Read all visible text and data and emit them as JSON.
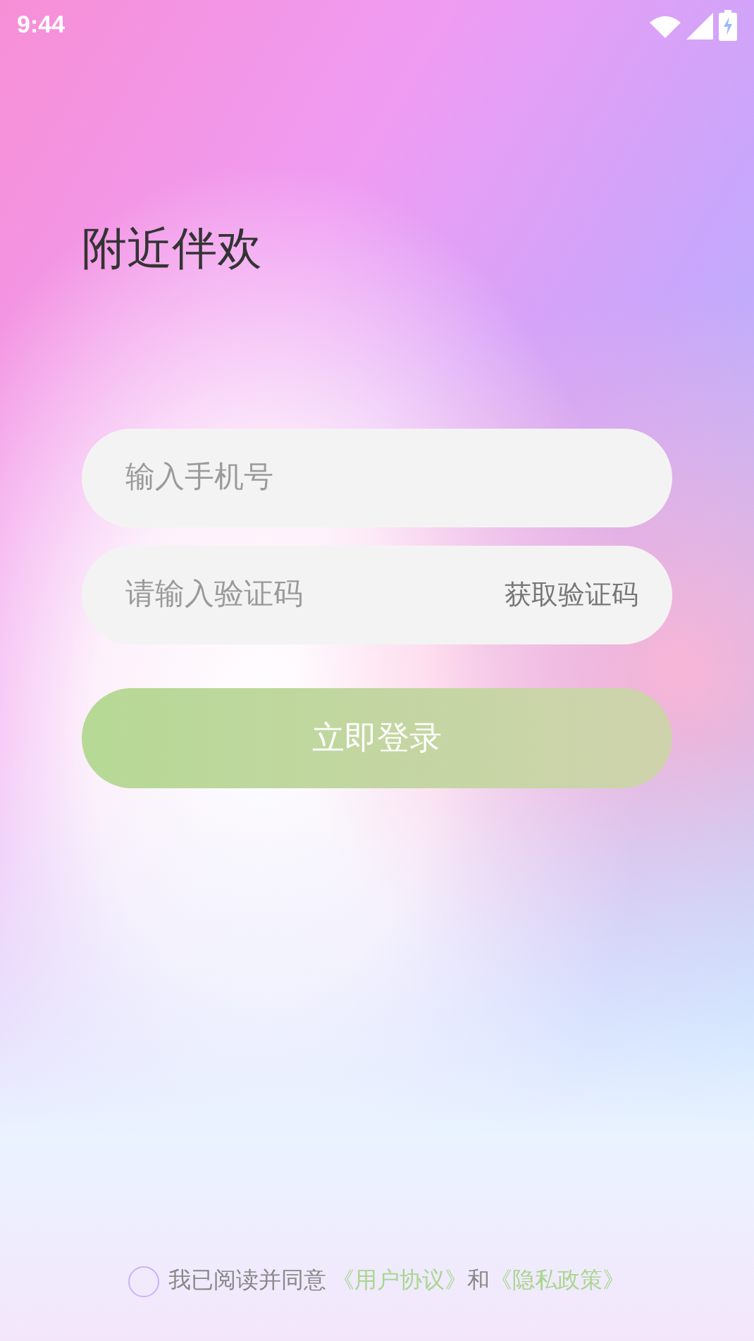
{
  "status_bar": {
    "time": "9:44"
  },
  "title": "附近伴欢",
  "phone_field": {
    "placeholder": "输入手机号"
  },
  "code_field": {
    "placeholder": "请输入验证码",
    "action": "获取验证码"
  },
  "login_button": {
    "label": "立即登录"
  },
  "agreement": {
    "checked": false,
    "text": "我已阅读并同意",
    "links": [
      {
        "label": "《用户协议》"
      },
      {
        "label": "《隐私政策》"
      }
    ],
    "joiner": "和"
  }
}
